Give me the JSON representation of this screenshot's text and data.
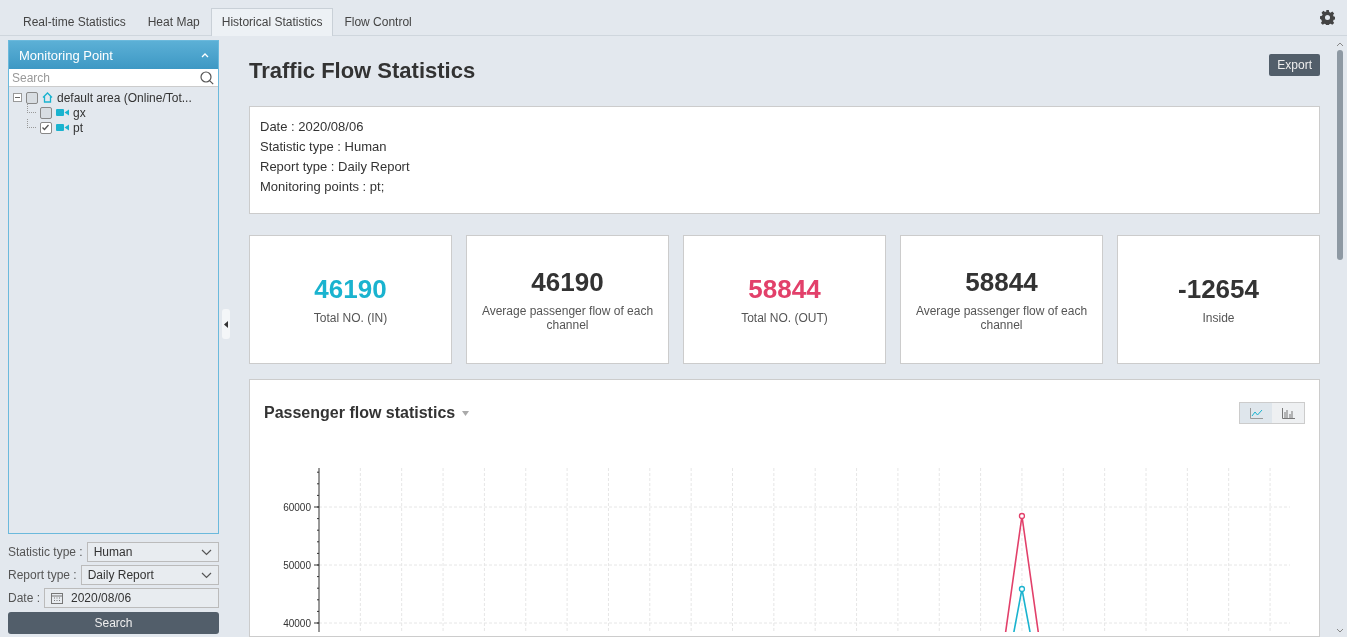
{
  "tabs": [
    {
      "label": "Real-time Statistics",
      "selected": false
    },
    {
      "label": "Heat Map",
      "selected": false
    },
    {
      "label": "Historical Statistics",
      "selected": true
    },
    {
      "label": "Flow Control",
      "selected": false
    }
  ],
  "sidebar": {
    "title": "Monitoring Point",
    "search": {
      "placeholder": "Search"
    },
    "tree": [
      {
        "label": "default area (Online/Tot...",
        "kind": "area",
        "checked": false,
        "expanded": true,
        "children": [
          {
            "label": "gx",
            "kind": "camera",
            "checked": false
          },
          {
            "label": "pt",
            "kind": "camera",
            "checked": true
          }
        ]
      }
    ],
    "form": [
      {
        "label": "Statistic type :",
        "kind": "select",
        "value": "Human"
      },
      {
        "label": "Report type :",
        "kind": "select",
        "value": "Daily Report"
      },
      {
        "label": "Date :",
        "kind": "date",
        "value": "2020/08/06"
      }
    ],
    "search_button": "Search"
  },
  "main": {
    "title": "Traffic Flow Statistics",
    "export_button": "Export",
    "info": [
      "Date : 2020/08/06",
      "Statistic type : Human",
      "Report type : Daily Report",
      "Monitoring points : pt;"
    ],
    "cards": [
      {
        "value": "46190",
        "label": "Total NO. (IN)",
        "color": "#1ab3cf"
      },
      {
        "value": "46190",
        "label": "Average passenger flow of each channel",
        "color": "#333333"
      },
      {
        "value": "58844",
        "label": "Total NO. (OUT)",
        "color": "#e2406a"
      },
      {
        "value": "58844",
        "label": "Average passenger flow of each channel",
        "color": "#333333"
      },
      {
        "value": "-12654",
        "label": "Inside",
        "color": "#333333"
      }
    ],
    "chart": {
      "title": "Passenger flow statistics",
      "views": [
        {
          "kind": "line",
          "selected": true
        },
        {
          "kind": "bar",
          "selected": false
        }
      ],
      "y_axis_labels": [
        "60000",
        "50000",
        "40000"
      ]
    }
  }
}
